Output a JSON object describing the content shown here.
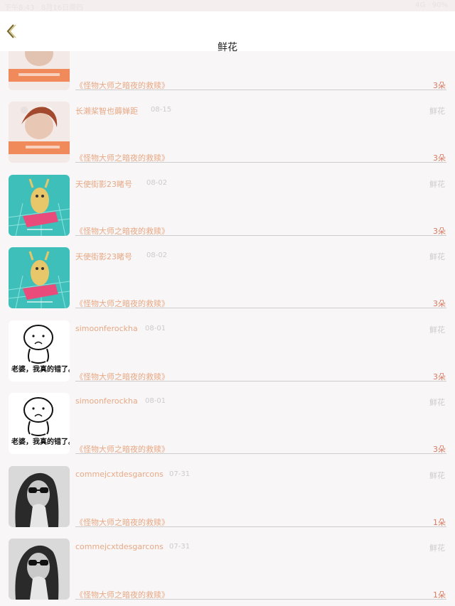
{
  "status_bar": {
    "left": "下午8:43 · 8月16日周四",
    "right": "4G · 90%"
  },
  "nav": {
    "title": "鲜花",
    "back_icon": "chevron-left-icon",
    "accent": "#7a6a2e"
  },
  "rows": [
    {
      "user": "",
      "date": "",
      "type": "",
      "book": "《怪物大师之暗夜的救赎》",
      "count": "3朵",
      "avatar": "flower-girl-avatar"
    },
    {
      "user": "长濑桨智也薅婵距",
      "date": "08-15",
      "type": "鲜花",
      "book": "《怪物大师之暗夜的救赎》",
      "count": "3朵",
      "avatar": "flower-girl-avatar"
    },
    {
      "user": "天使街影23睹号",
      "date": "08-02",
      "type": "鲜花",
      "book": "《怪物大师之暗夜的救赎》",
      "count": "3朵",
      "avatar": "cartoon-scale-avatar"
    },
    {
      "user": "天使街影23睹号",
      "date": "08-02",
      "type": "鲜花",
      "book": "《怪物大师之暗夜的救赎》",
      "count": "3朵",
      "avatar": "cartoon-scale-avatar"
    },
    {
      "user": "simoonferockha",
      "date": "08-01",
      "type": "鲜花",
      "book": "《怪物大师之暗夜的救赎》",
      "count": "3朵",
      "avatar": "sad-doodle-avatar",
      "avatar_caption": "老婆，我真的错了。"
    },
    {
      "user": "simoonferockha",
      "date": "08-01",
      "type": "鲜花",
      "book": "《怪物大师之暗夜的救赎》",
      "count": "3朵",
      "avatar": "sad-doodle-avatar",
      "avatar_caption": "老婆，我真的错了。"
    },
    {
      "user": "commejcxtdesgarcons",
      "date": "07-31",
      "type": "鲜花",
      "book": "《怪物大师之暗夜的救赎》",
      "count": "1朵",
      "avatar": "sunglasses-woman-avatar"
    },
    {
      "user": "commejcxtdesgarcons",
      "date": "07-31",
      "type": "鲜花",
      "book": "《怪物大师之暗夜的救赎》",
      "count": "1朵",
      "avatar": "sunglasses-woman-avatar"
    }
  ]
}
